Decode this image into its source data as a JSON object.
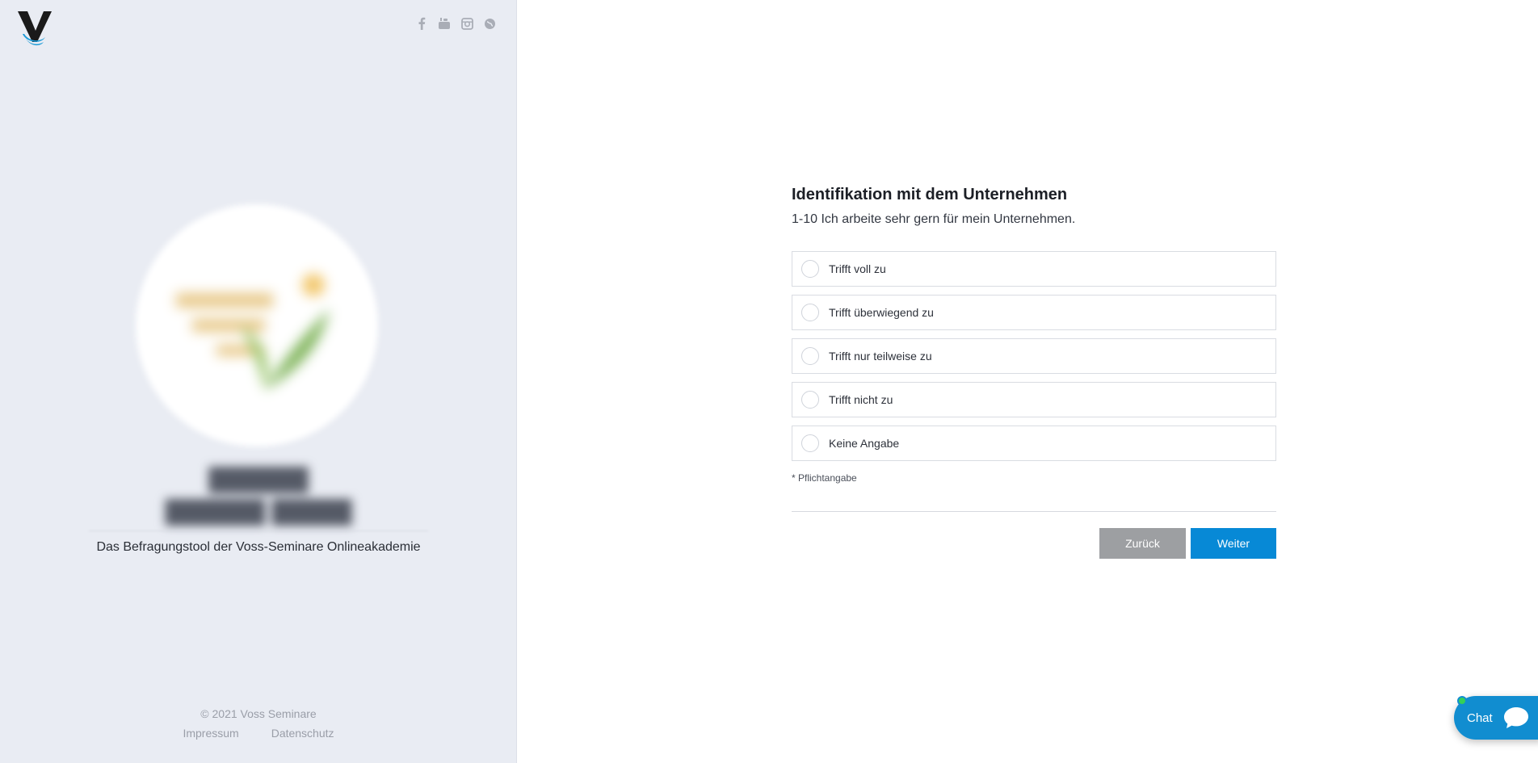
{
  "sidebar": {
    "social_icons": [
      "facebook-icon",
      "youtube-icon",
      "instagram-icon",
      "globe-icon"
    ],
    "tagline": "Das Befragungstool der Voss-Seminare Onlineakademie",
    "footer": {
      "copyright": "© 2021 Voss Seminare",
      "impressum": "Impressum",
      "datenschutz": "Datenschutz"
    }
  },
  "survey": {
    "title": "Identifikation mit dem Unternehmen",
    "question": "1-10 Ich arbeite sehr gern für mein Unternehmen.",
    "options": [
      "Trifft voll zu",
      "Trifft überwiegend zu",
      "Trifft nur teilweise zu",
      "Trifft nicht zu",
      "Keine Angabe"
    ],
    "required_note": "* Pflichtangabe",
    "back_label": "Zurück",
    "next_label": "Weiter"
  },
  "chat": {
    "label": "Chat"
  },
  "colors": {
    "sidebar_bg": "#e9ecf3",
    "primary": "#0789d6",
    "back_button": "#9d9fa2",
    "chat": "#118dd0",
    "online": "#34d058"
  }
}
